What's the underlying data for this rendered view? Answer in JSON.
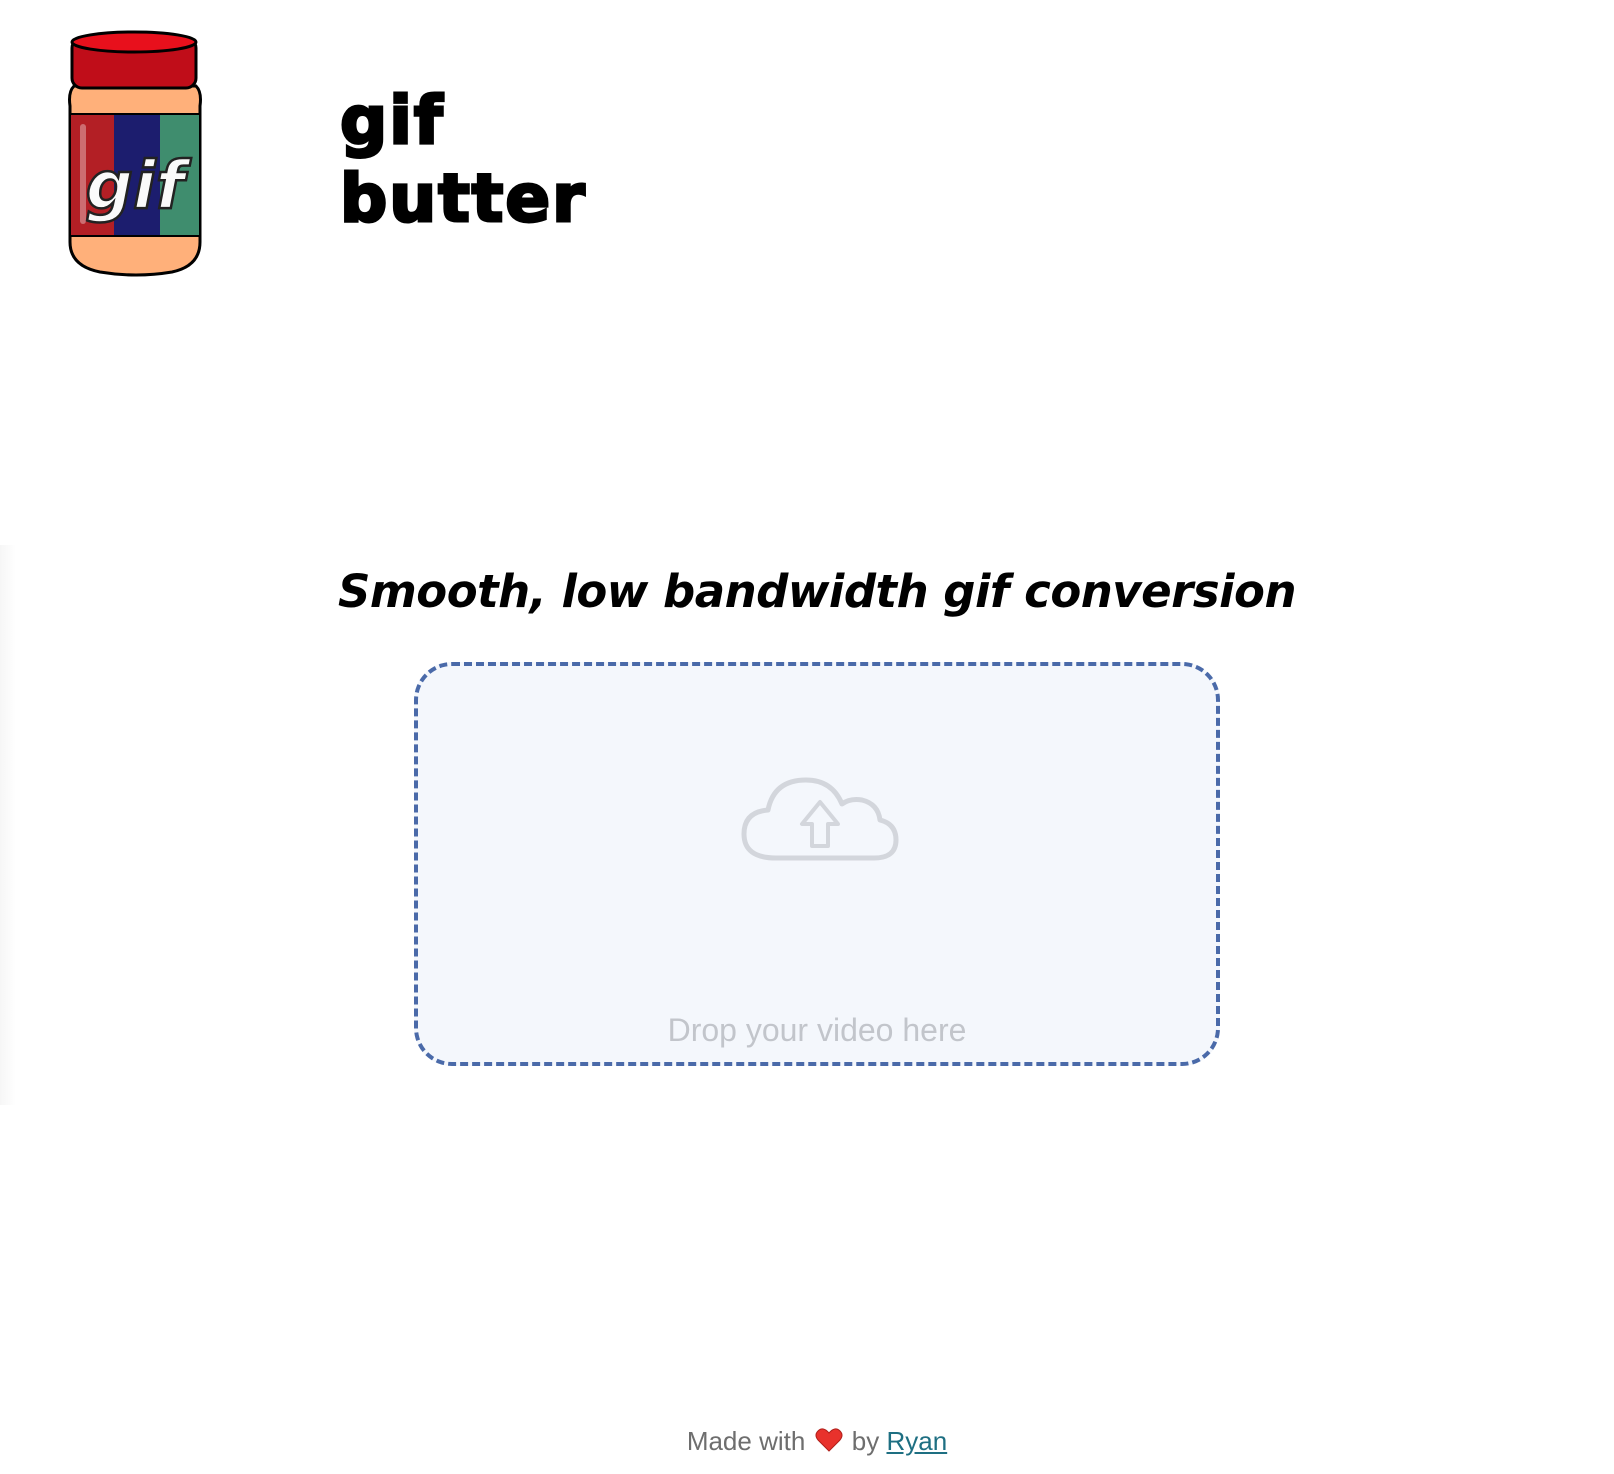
{
  "header": {
    "logo_label": "gif",
    "brand_line1": "gif",
    "brand_line2": "butter"
  },
  "main": {
    "tagline": "Smooth, low bandwidth gif conversion",
    "dropzone": {
      "label": "Drop your video here",
      "icon": "cloud-upload-icon"
    }
  },
  "footer": {
    "prefix": "Made with",
    "heart_icon": "heart-icon",
    "by": "by",
    "author_link": "Ryan"
  },
  "colors": {
    "dropzone_border": "#4a6aa9",
    "dropzone_bg": "#f4f7fc",
    "link": "#1e6f82",
    "jar_lid": "#d8101e",
    "jar_body": "#ffb07a"
  }
}
